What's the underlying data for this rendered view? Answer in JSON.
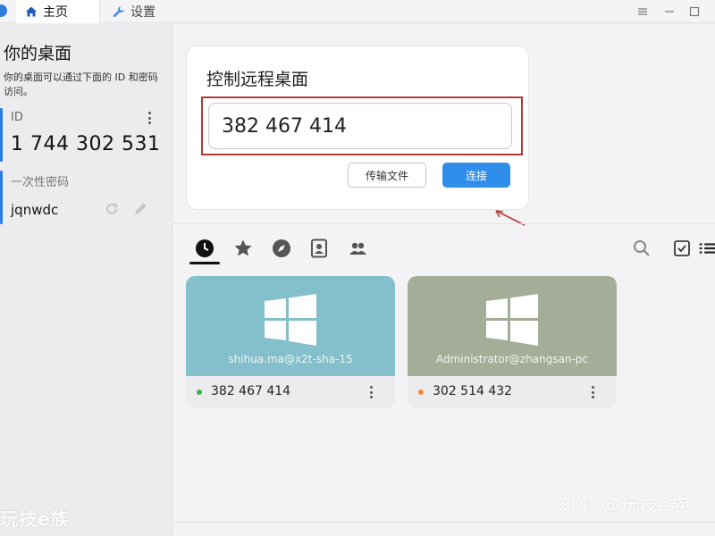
{
  "tabs": [
    {
      "label": "主页",
      "icon": "home-icon"
    },
    {
      "label": "设置",
      "icon": "wrench-icon"
    }
  ],
  "window_controls": [
    "menu-icon",
    "minimize-icon",
    "maximize-icon"
  ],
  "sidebar": {
    "title": "你的桌面",
    "description": "你的桌面可以通过下面的 ID 和密码访问。",
    "id_label": "ID",
    "id_value": "1 744 302 531",
    "password_label": "一次性密码",
    "password_value": "jqnwdc"
  },
  "connect": {
    "title": "控制远程桌面",
    "input_value": "382 467 414",
    "transfer_label": "传输文件",
    "connect_label": "连接"
  },
  "toolbar_tabs": [
    "recent-icon",
    "star-icon",
    "compass-icon",
    "address-book-icon",
    "group-icon"
  ],
  "toolbar_right": [
    "search-icon",
    "checkbox-icon",
    "list-view-icon"
  ],
  "peers": [
    {
      "user": "shihua.ma@x2t-sha-15",
      "id": "382 467 414",
      "thumb_color": "#84bfcc",
      "status_color": "#3db24a"
    },
    {
      "user": "Administrator@zhangsan-pc",
      "id": "302 514 432",
      "thumb_color": "#a4ad98",
      "status_color": "#ef8a3a"
    }
  ],
  "watermarks": {
    "left": "玩技e族",
    "right": "知乎 @玩技e族"
  },
  "colors": {
    "accent": "#2f8ee9",
    "sidebar_bar": "#2b7de0",
    "highlight_box": "#b23a3a"
  }
}
